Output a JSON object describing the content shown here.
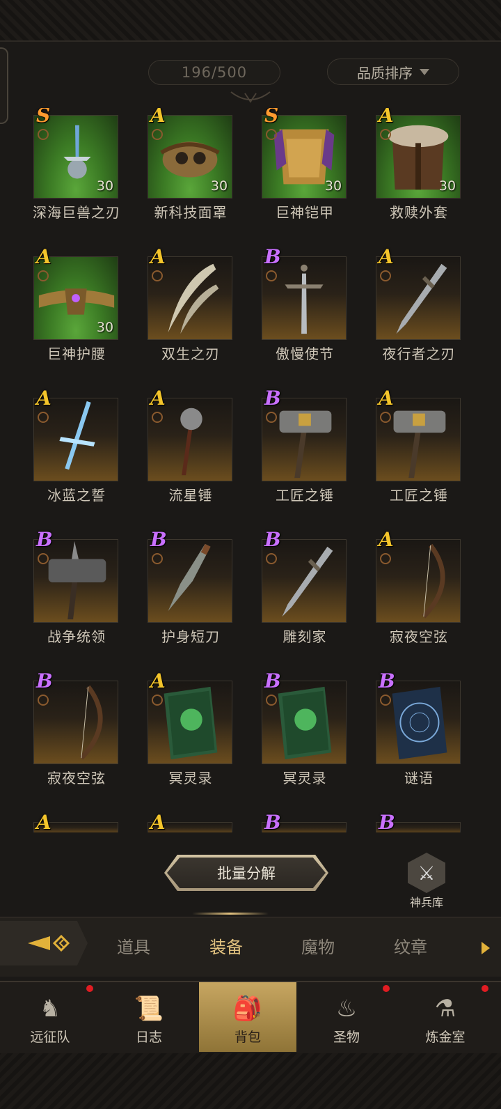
{
  "header": {
    "capacity": "196/500",
    "sort_label": "品质排序"
  },
  "items": [
    {
      "name": "深海巨兽之刃",
      "grade": "S",
      "level": "30",
      "bg": "green",
      "icon": "sword-icon"
    },
    {
      "name": "新科技面罩",
      "grade": "A",
      "level": "30",
      "bg": "green",
      "icon": "mask-icon"
    },
    {
      "name": "巨神铠甲",
      "grade": "S",
      "level": "30",
      "bg": "green",
      "icon": "armor-icon"
    },
    {
      "name": "救赎外套",
      "grade": "A",
      "level": "30",
      "bg": "green",
      "icon": "coat-icon"
    },
    {
      "name": "巨神护腰",
      "grade": "A",
      "level": "30",
      "bg": "green",
      "icon": "belt-icon"
    },
    {
      "name": "双生之刃",
      "grade": "A",
      "level": "",
      "bg": "gold",
      "icon": "dual-blade-icon"
    },
    {
      "name": "傲慢使节",
      "grade": "B",
      "level": "",
      "bg": "gold",
      "icon": "greatsword-icon"
    },
    {
      "name": "夜行者之刃",
      "grade": "A",
      "level": "",
      "bg": "gold",
      "icon": "dagger-icon"
    },
    {
      "name": "冰蓝之誓",
      "grade": "A",
      "level": "",
      "bg": "gold",
      "icon": "ice-sword-icon"
    },
    {
      "name": "流星锤",
      "grade": "A",
      "level": "",
      "bg": "gold",
      "icon": "mace-icon"
    },
    {
      "name": "工匠之锤",
      "grade": "B",
      "level": "",
      "bg": "gold",
      "icon": "hammer-icon"
    },
    {
      "name": "工匠之锤",
      "grade": "A",
      "level": "",
      "bg": "gold",
      "icon": "hammer-icon"
    },
    {
      "name": "战争统领",
      "grade": "B",
      "level": "",
      "bg": "gold",
      "icon": "warhammer-icon"
    },
    {
      "name": "护身短刀",
      "grade": "B",
      "level": "",
      "bg": "gold",
      "icon": "knife-icon"
    },
    {
      "name": "雕刻家",
      "grade": "B",
      "level": "",
      "bg": "gold",
      "icon": "dagger-icon"
    },
    {
      "name": "寂夜空弦",
      "grade": "A",
      "level": "",
      "bg": "gold",
      "icon": "bow-icon"
    },
    {
      "name": "寂夜空弦",
      "grade": "B",
      "level": "",
      "bg": "gold",
      "icon": "bow-icon"
    },
    {
      "name": "冥灵录",
      "grade": "A",
      "level": "",
      "bg": "gold",
      "icon": "book-icon"
    },
    {
      "name": "冥灵录",
      "grade": "B",
      "level": "",
      "bg": "gold",
      "icon": "book-icon"
    },
    {
      "name": "谜语",
      "grade": "B",
      "level": "",
      "bg": "gold",
      "icon": "tome-icon"
    },
    {
      "name": "",
      "grade": "A",
      "level": "",
      "bg": "gold",
      "icon": ""
    },
    {
      "name": "",
      "grade": "A",
      "level": "",
      "bg": "gold",
      "icon": ""
    },
    {
      "name": "",
      "grade": "B",
      "level": "",
      "bg": "gold",
      "icon": ""
    },
    {
      "name": "",
      "grade": "B",
      "level": "",
      "bg": "gold",
      "icon": ""
    }
  ],
  "actions": {
    "bulk_dismantle": "批量分解",
    "armory": "神兵库"
  },
  "tabs": [
    {
      "label": "道具",
      "active": false
    },
    {
      "label": "装备",
      "active": true
    },
    {
      "label": "魔物",
      "active": false
    },
    {
      "label": "纹章",
      "active": false
    }
  ],
  "nav": [
    {
      "label": "远征队",
      "icon": "viking-helmet-icon",
      "badge": true,
      "active": false
    },
    {
      "label": "日志",
      "icon": "scroll-icon",
      "badge": false,
      "active": false
    },
    {
      "label": "背包",
      "icon": "backpack-icon",
      "badge": false,
      "active": true
    },
    {
      "label": "圣物",
      "icon": "torch-icon",
      "badge": true,
      "active": false
    },
    {
      "label": "炼金室",
      "icon": "alchemy-icon",
      "badge": true,
      "active": false
    }
  ],
  "colors": {
    "grade_S": "#ff9b2f",
    "grade_A": "#f4c52b",
    "grade_B": "#c970ff",
    "accent": "#e2c27f",
    "badge_red": "#e01c22"
  }
}
